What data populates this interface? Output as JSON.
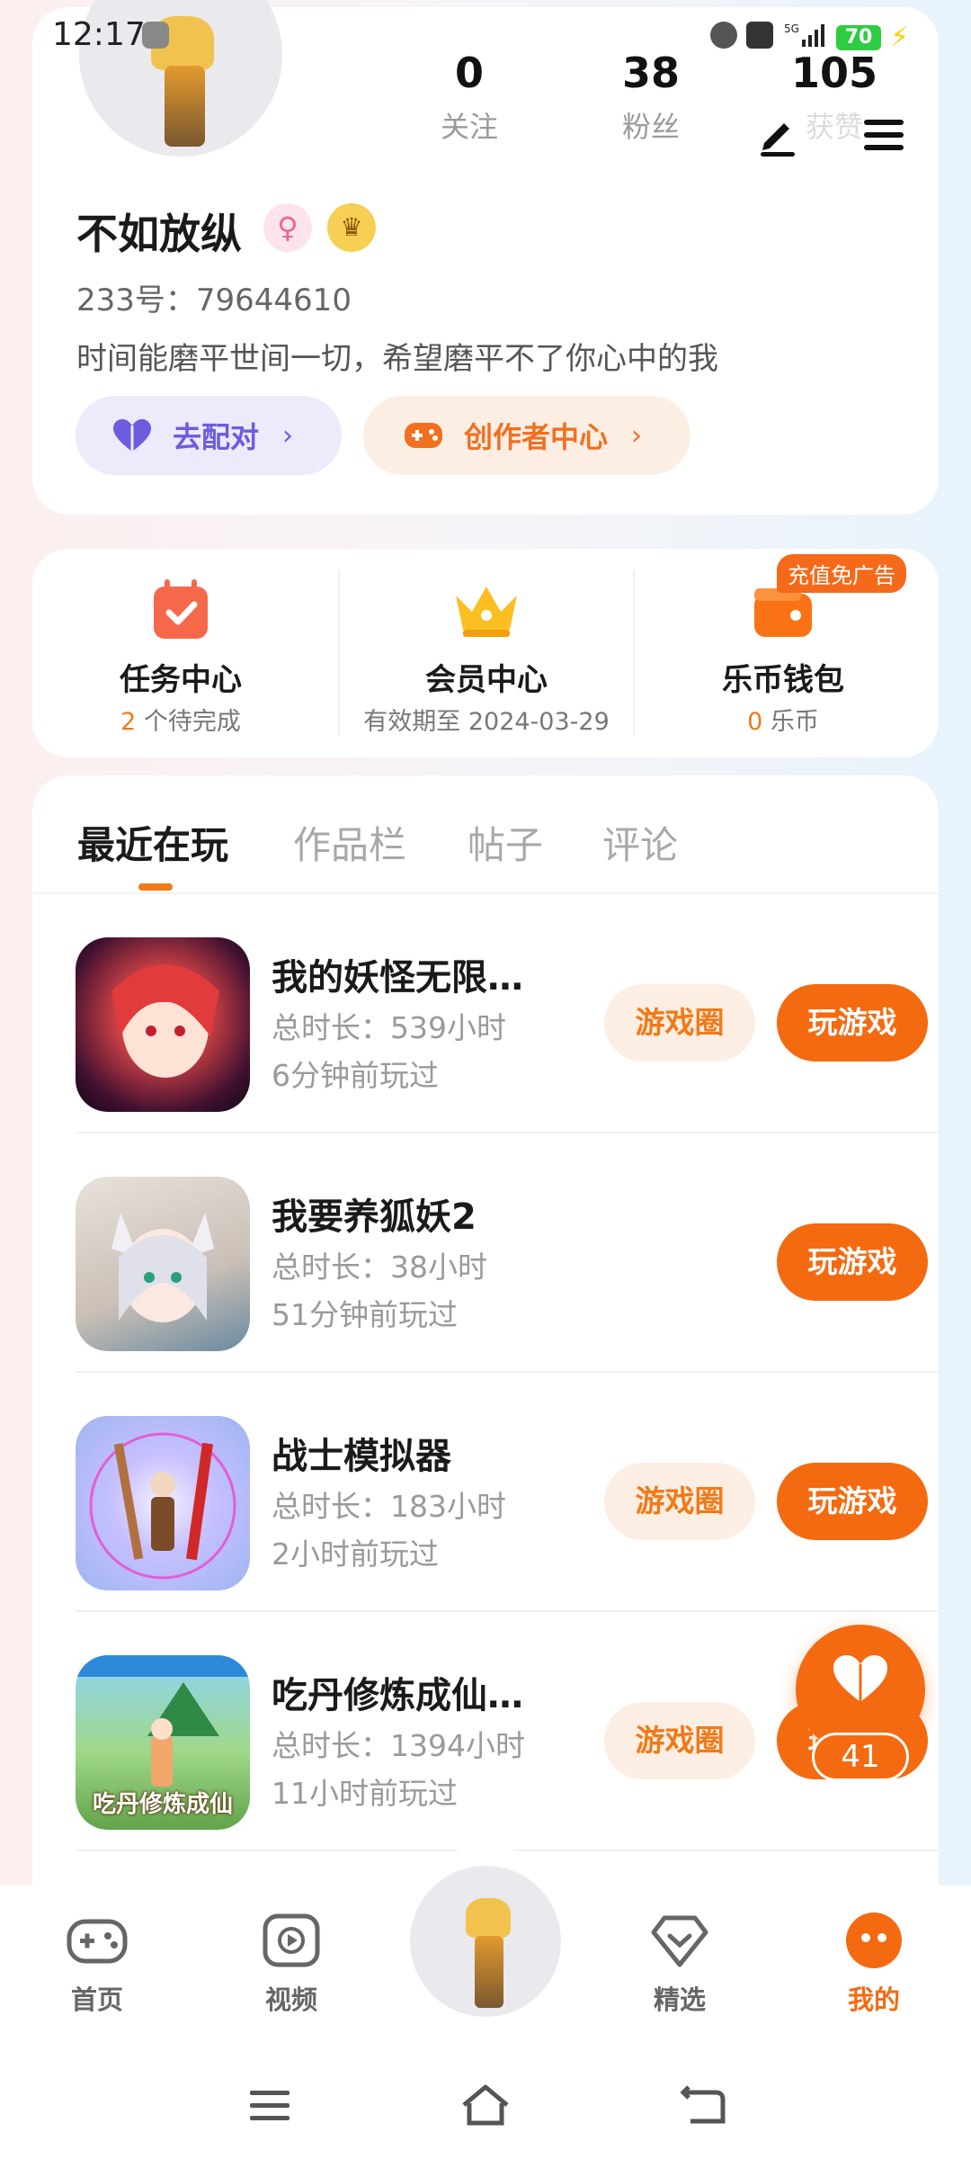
{
  "status_bar": {
    "time": "12:17",
    "battery": "70",
    "network": "5G"
  },
  "profile": {
    "stats": [
      {
        "value": "0",
        "label": "关注"
      },
      {
        "value": "38",
        "label": "粉丝"
      },
      {
        "value": "105",
        "label": "获赞"
      }
    ],
    "username": "不如放纵",
    "uid_label": "233号：79644610",
    "bio": "时间能磨平世间一切，希望磨平不了你心中的我",
    "match_button": "去配对",
    "creator_button": "创作者中心"
  },
  "services": [
    {
      "title": "任务中心",
      "sub_value": "2",
      "sub_text": " 个待完成"
    },
    {
      "title": "会员中心",
      "sub_value": "",
      "sub_text": "有效期至 2024-03-29"
    },
    {
      "title": "乐币钱包",
      "sub_value": "0",
      "sub_text": " 乐币",
      "tag": "充值免广告"
    }
  ],
  "tabs": [
    "最近在玩",
    "作品栏",
    "帖子",
    "评论"
  ],
  "games": [
    {
      "name": "我的妖怪无限…",
      "total_time": "总时长：539小时",
      "last_played": "6分钟前玩过",
      "circle_btn": "游戏圈",
      "play_btn": "玩游戏"
    },
    {
      "name": "我要养狐妖2",
      "total_time": "总时长：38小时",
      "last_played": "51分钟前玩过",
      "circle_btn": "",
      "play_btn": "玩游戏"
    },
    {
      "name": "战士模拟器",
      "total_time": "总时长：183小时",
      "last_played": "2小时前玩过",
      "circle_btn": "游戏圈",
      "play_btn": "玩游戏"
    },
    {
      "name": "吃丹修炼成仙…",
      "total_time": "总时长：1394小时",
      "last_played": "11小时前玩过",
      "circle_btn": "游戏圈",
      "play_btn": "玩游戏",
      "thumb_text": "吃丹修炼成仙"
    }
  ],
  "like_fab": {
    "count": "41"
  },
  "bottom_nav": [
    {
      "label": "首页",
      "icon": "gamepad-icon"
    },
    {
      "label": "视频",
      "icon": "video-play-icon"
    },
    {
      "label": "精选",
      "icon": "heart-gem-icon"
    },
    {
      "label": "我的",
      "icon": "profile-face-icon"
    }
  ],
  "colors": {
    "accent": "#f46a10",
    "accent_light": "#fdeee3",
    "purple": "#6b5ce0"
  }
}
